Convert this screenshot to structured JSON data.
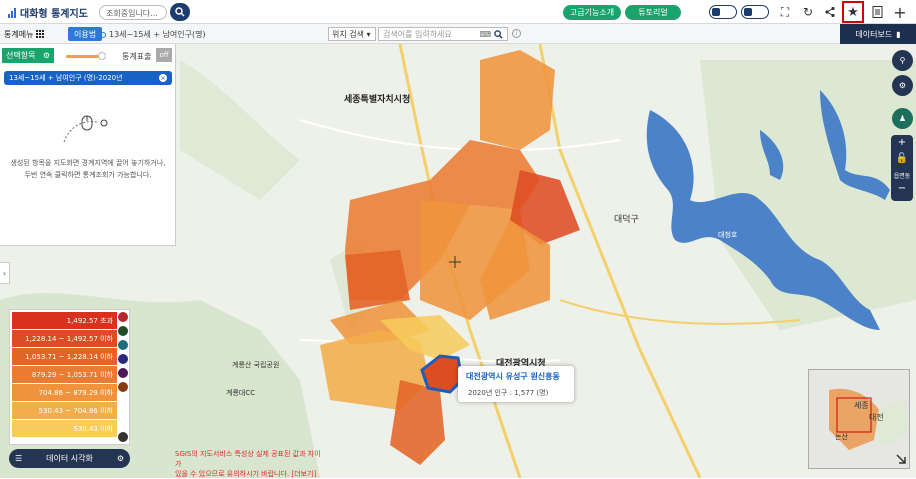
{
  "header": {
    "app_title": "대화형 통계지도",
    "location_placeholder": "조회중입니다...",
    "advanced_label": "고급기능소개",
    "tutorial_label": "튜토리얼"
  },
  "toolbar2": {
    "menu_label": "통계메뉴",
    "usage_tag": "이용법",
    "breadcrumb": "13세~15세 + 남여인구(명)",
    "search_type": "위치 검색",
    "search_placeholder": "검색어를 입력하세요",
    "dashboard_label": "데이터보드"
  },
  "left_panel": {
    "select_item_label": "선택항목",
    "stat_table_label": "통계표출",
    "off_label": "off",
    "chip": "13세~15세 + 남여인구 (명)-2020년",
    "help_line1": "생성된 항목을 지도화면 경계지역에 끌어 놓기하거나,",
    "help_line2": "두번 연속 클릭하면 통계조회가 가능합니다."
  },
  "legend": {
    "rows": [
      {
        "label": "1,492.57 초과",
        "color": "#d8321e"
      },
      {
        "label": "1,228.14 ~ 1,492.57 이하",
        "color": "#de4c22"
      },
      {
        "label": "1,053.71 ~ 1,228.14 이하",
        "color": "#e46428"
      },
      {
        "label": "879.29 ~ 1,053.71 이하",
        "color": "#ea7b32"
      },
      {
        "label": "704.86 ~ 879.29 이하",
        "color": "#ef943c"
      },
      {
        "label": "530.43 ~ 704.86 이하",
        "color": "#f3ad4a"
      },
      {
        "label": "530.43 이하",
        "color": "#f7cb5c"
      }
    ],
    "dot_colors": [
      "#b3282d",
      "#1d4d2a",
      "#1d6e7c",
      "#2a2a7a",
      "#4a1a55",
      "#8a3a10"
    ],
    "data_vis_label": "데이터 시각화"
  },
  "notice": {
    "line1": "SGIS의 지도서비스 특성상 실제 공표된 값과 차이가",
    "line2": "있을 수 있으므로 유의하시기 바랍니다. [더보기]"
  },
  "tooltip": {
    "title": "대전광역시 유성구 원신흥동",
    "value": "2020년 인구 : 1,577 (명)"
  },
  "map_labels": {
    "sejong": "세종특별자치시청",
    "daedeok": "대덕구",
    "daejeon_hall": "대전광역시청",
    "gyeryong": "계룡산 국립공원",
    "gyeryong_cc": "계룡대CC",
    "daecheong": "대청호",
    "minimap_sejong": "세종",
    "minimap_daejeon": "대전",
    "minimap_nonsan": "논산"
  },
  "map_tools": {
    "zoom_in": "+",
    "zoom_out": "−",
    "area_label": "읍면동"
  },
  "colors": {
    "navy": "#1d3c6e",
    "green": "#1aa46b",
    "blue": "#1762c4",
    "highlight_red": "#d40000"
  }
}
